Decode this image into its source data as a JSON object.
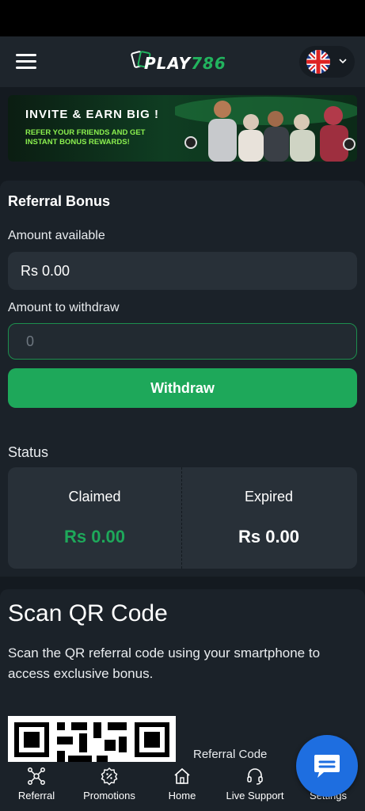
{
  "header": {
    "logo_text_prefix": "PLAY",
    "logo_text_number": "786",
    "language": "English (UK) flag"
  },
  "banner": {
    "title": "INVITE & EARN BIG !",
    "subtitle": "REFER YOUR FRIENDS AND GET INSTANT BONUS REWARDS!"
  },
  "referral": {
    "title": "Referral Bonus",
    "amount_available_label": "Amount available",
    "amount_available_value": "Rs 0.00",
    "amount_to_withdraw_label": "Amount to withdraw",
    "amount_to_withdraw_placeholder": "0",
    "withdraw_button": "Withdraw"
  },
  "status": {
    "label": "Status",
    "claimed_label": "Claimed",
    "claimed_value": "Rs 0.00",
    "expired_label": "Expired",
    "expired_value": "Rs 0.00"
  },
  "qr": {
    "title": "Scan QR Code",
    "description": "Scan the QR referral code using your smartphone to access exclusive bonus.",
    "referral_code_label": "Referral Code"
  },
  "nav": {
    "items": [
      {
        "label": "Referral",
        "icon": "referral-network-icon"
      },
      {
        "label": "Promotions",
        "icon": "promotions-badge-icon"
      },
      {
        "label": "Home",
        "icon": "home-icon"
      },
      {
        "label": "Live Support",
        "icon": "headset-icon"
      },
      {
        "label": "Settings",
        "icon": "settings-icon"
      }
    ]
  },
  "colors": {
    "accent_green": "#1ea85a",
    "claimed_green": "#1ea85a",
    "chat_blue": "#1e6ee0",
    "background": "#141a20",
    "card": "#1b2229"
  }
}
